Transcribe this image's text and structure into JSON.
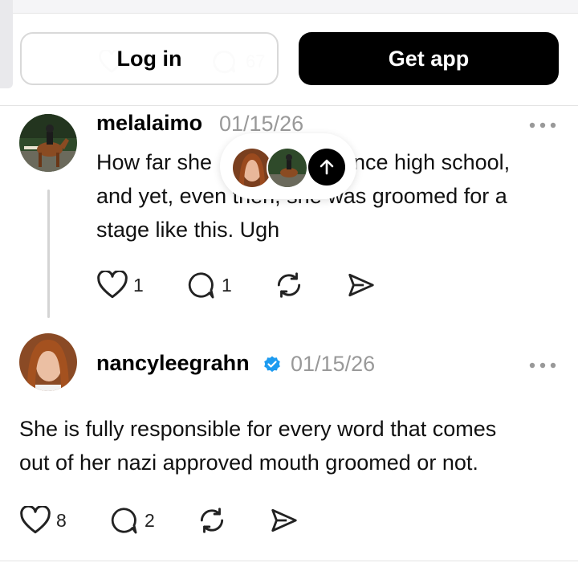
{
  "header": {
    "login_label": "Log in",
    "get_app_label": "Get app",
    "ghost_count": "67"
  },
  "posts": [
    {
      "username": "melalaimo",
      "date": "01/15/26",
      "text_line1": "How far she",
      "text_line1_end": "ince high school,",
      "text_line2": "and yet, even then, she was groomed for a",
      "text_line3": "stage like this. Ugh",
      "likes": "1",
      "replies": "1",
      "avatar_icon": "horse-rider-avatar-icon"
    },
    {
      "username": "nancyleegrahn",
      "verified": true,
      "date": "01/15/26",
      "text_line1": "She is fully responsible for every word that comes",
      "text_line2": "out of her nazi approved mouth groomed or not.",
      "likes": "8",
      "replies": "2",
      "avatar_icon": "woman-portrait-avatar-icon"
    }
  ],
  "colors": {
    "accent_verified": "#1d9bf0",
    "muted": "#999999",
    "divider": "#e3e3e3"
  }
}
